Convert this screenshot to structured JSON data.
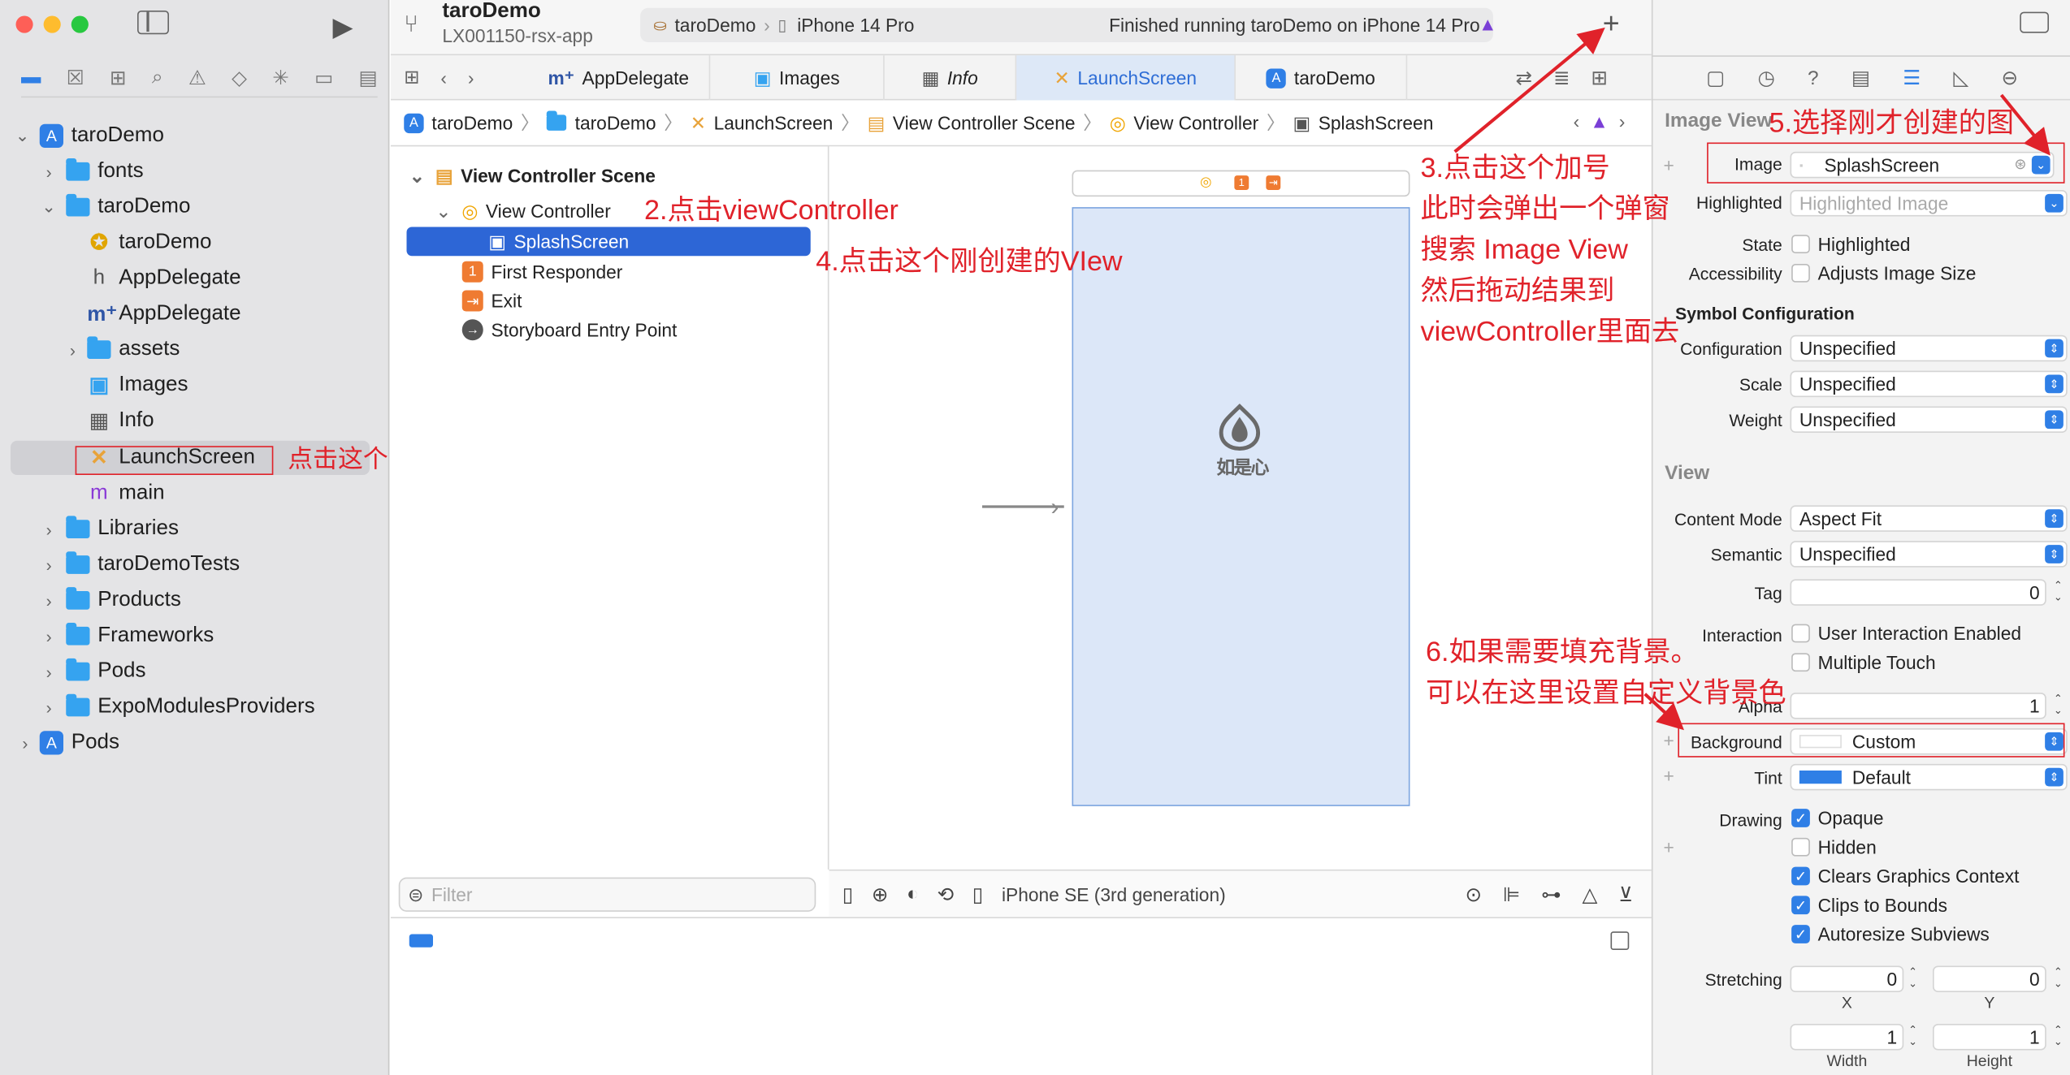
{
  "window": {
    "title": "taroDemo",
    "subtitle": "LX001150-rsx-app"
  },
  "scheme": {
    "target": "taroDemo",
    "device": "iPhone 14 Pro",
    "status": "Finished running taroDemo on iPhone 14 Pro"
  },
  "navigator": {
    "items": [
      {
        "label": "taroDemo",
        "type": "project"
      },
      {
        "label": "fonts",
        "type": "folder"
      },
      {
        "label": "taroDemo",
        "type": "folder"
      },
      {
        "label": "taroDemo",
        "type": "entitlements"
      },
      {
        "label": "AppDelegate",
        "type": "header"
      },
      {
        "label": "AppDelegate",
        "type": "objc"
      },
      {
        "label": "assets",
        "type": "folder"
      },
      {
        "label": "Images",
        "type": "assets"
      },
      {
        "label": "Info",
        "type": "plist"
      },
      {
        "label": "LaunchScreen",
        "type": "storyboard"
      },
      {
        "label": "main",
        "type": "objc"
      },
      {
        "label": "Libraries",
        "type": "folder"
      },
      {
        "label": "taroDemoTests",
        "type": "folder"
      },
      {
        "label": "Products",
        "type": "folder"
      },
      {
        "label": "Frameworks",
        "type": "folder"
      },
      {
        "label": "Pods",
        "type": "folder"
      },
      {
        "label": "ExpoModulesProviders",
        "type": "folder"
      },
      {
        "label": "Pods",
        "type": "project"
      }
    ]
  },
  "tabs": [
    {
      "label": "AppDelegate",
      "active": false
    },
    {
      "label": "Images",
      "active": false
    },
    {
      "label": "Info",
      "active": false
    },
    {
      "label": "LaunchScreen",
      "active": true
    },
    {
      "label": "taroDemo",
      "active": false
    }
  ],
  "jumpbar": [
    "taroDemo",
    "taroDemo",
    "LaunchScreen",
    "View Controller Scene",
    "View Controller",
    "SplashScreen"
  ],
  "outline": {
    "scene": "View Controller Scene",
    "controller": "View Controller",
    "selected": "SplashScreen",
    "responder": "First Responder",
    "exit": "Exit",
    "entry": "Storyboard Entry Point",
    "filter_placeholder": "Filter"
  },
  "canvas": {
    "device": "iPhone SE (3rd generation)",
    "logo_text": "如是心"
  },
  "inspector": {
    "section_image_view": "Image View",
    "image_label": "Image",
    "image_value": "SplashScreen",
    "highlighted_label": "Highlighted",
    "highlighted_placeholder": "Highlighted Image",
    "state_label": "State",
    "state_option": "Highlighted",
    "accessibility_label": "Accessibility",
    "accessibility_option": "Adjusts Image Size",
    "symbol_header": "Symbol Configuration",
    "configuration_label": "Configuration",
    "configuration_value": "Unspecified",
    "scale_label": "Scale",
    "scale_value": "Unspecified",
    "weight_label": "Weight",
    "weight_value": "Unspecified",
    "section_view": "View",
    "content_mode_label": "Content Mode",
    "content_mode_value": "Aspect Fit",
    "semantic_label": "Semantic",
    "semantic_value": "Unspecified",
    "tag_label": "Tag",
    "tag_value": "0",
    "interaction_label": "Interaction",
    "user_interaction": "User Interaction Enabled",
    "multiple_touch": "Multiple Touch",
    "alpha_label": "Alpha",
    "alpha_value": "1",
    "background_label": "Background",
    "background_value": "Custom",
    "tint_label": "Tint",
    "tint_value": "Default",
    "drawing_label": "Drawing",
    "opaque": "Opaque",
    "hidden": "Hidden",
    "clears": "Clears Graphics Context",
    "clips": "Clips to Bounds",
    "autoresize": "Autoresize Subviews",
    "stretching_label": "Stretching",
    "stretch_x": "0",
    "stretch_y": "0",
    "x_label": "X",
    "y_label": "Y",
    "stretch_w": "1",
    "stretch_h": "1",
    "width_label": "Width",
    "height_label": "Height"
  },
  "annotations": {
    "a1": "点击这个",
    "a2": "2.点击viewController",
    "a3_1": "3.点击这个加号",
    "a3_2": "此时会弹出一个弹窗",
    "a3_3": "搜索 Image View",
    "a3_4": "然后拖动结果到",
    "a3_5": "viewController里面去",
    "a4": "4.点击这个刚创建的VIew",
    "a5": "5.选择刚才创建的图",
    "a6_1": "6.如果需要填充背景。",
    "a6_2": "可以在这里设置自定义背景色"
  },
  "colors": {
    "accent": "#2f7fe6",
    "annotation": "#e0222a",
    "canvas_view": "#dce7f8"
  }
}
